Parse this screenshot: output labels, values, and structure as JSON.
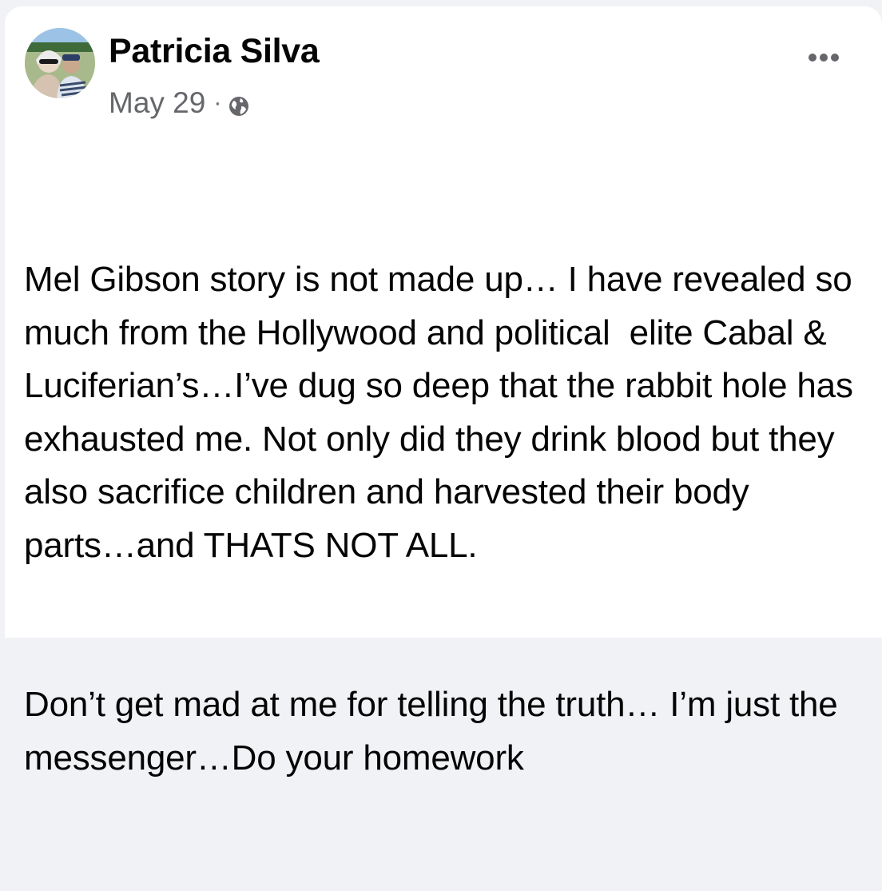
{
  "post": {
    "author": {
      "name": "Patricia Silva",
      "avatar_icon": "profile-photo"
    },
    "date": "May 29",
    "separator": "·",
    "audience_icon": "globe-icon",
    "more_icon": "more-options-icon",
    "body_paragraphs": [
      "Mel Gibson story is not made up… I have revealed so much from the Hollywood and political  elite Cabal & Luciferian’s…I’ve dug so deep that the rabbit hole has exhausted me. Not only did they drink blood but they also sacrifice children and harvested their body parts…and THATS NOT ALL.",
      "Don’t get mad at me for telling the truth… I’m just the messenger…Do your homework"
    ]
  },
  "colors": {
    "page_background": "#f0f2f5",
    "card_background": "#ffffff",
    "primary_text": "#050505",
    "secondary_text": "#65676b"
  }
}
